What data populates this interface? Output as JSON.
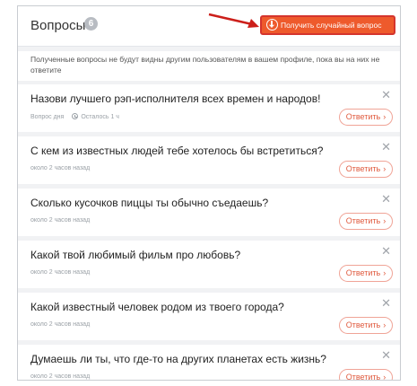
{
  "header": {
    "title": "Вопросы",
    "count": "6",
    "random_button_label": "Получить случайный вопрос"
  },
  "notice": "Полученные вопросы не будут видны другим пользователям в вашем профиле, пока вы на них не ответите",
  "answer_label": "Ответить",
  "colors": {
    "accent": "#ee5a2c",
    "accent_border": "#d4342d",
    "answer_text": "#e05a3e",
    "background": "#f1f2f4"
  },
  "icons": {
    "download": "download-circle-icon",
    "close": "close-icon",
    "clock": "clock-icon",
    "chevron": "chevron-right-icon"
  },
  "questions": [
    {
      "text": "Назови лучшего рэп-исполнителя всех времен и народов!",
      "meta": "Вопрос дня",
      "time_left": "Осталось 1 ч"
    },
    {
      "text": "С кем из известных людей тебе хотелось бы встретиться?",
      "meta": "около 2 часов назад"
    },
    {
      "text": "Сколько кусочков пиццы ты обычно съедаешь?",
      "meta": "около 2 часов назад"
    },
    {
      "text": "Какой твой любимый фильм про любовь?",
      "meta": "около 2 часов назад"
    },
    {
      "text": "Какой известный человек родом из твоего города?",
      "meta": "около 2 часов назад"
    },
    {
      "text": "Думаешь ли ты, что где-то на других планетах есть жизнь?",
      "meta": "около 2 часов назад"
    }
  ]
}
